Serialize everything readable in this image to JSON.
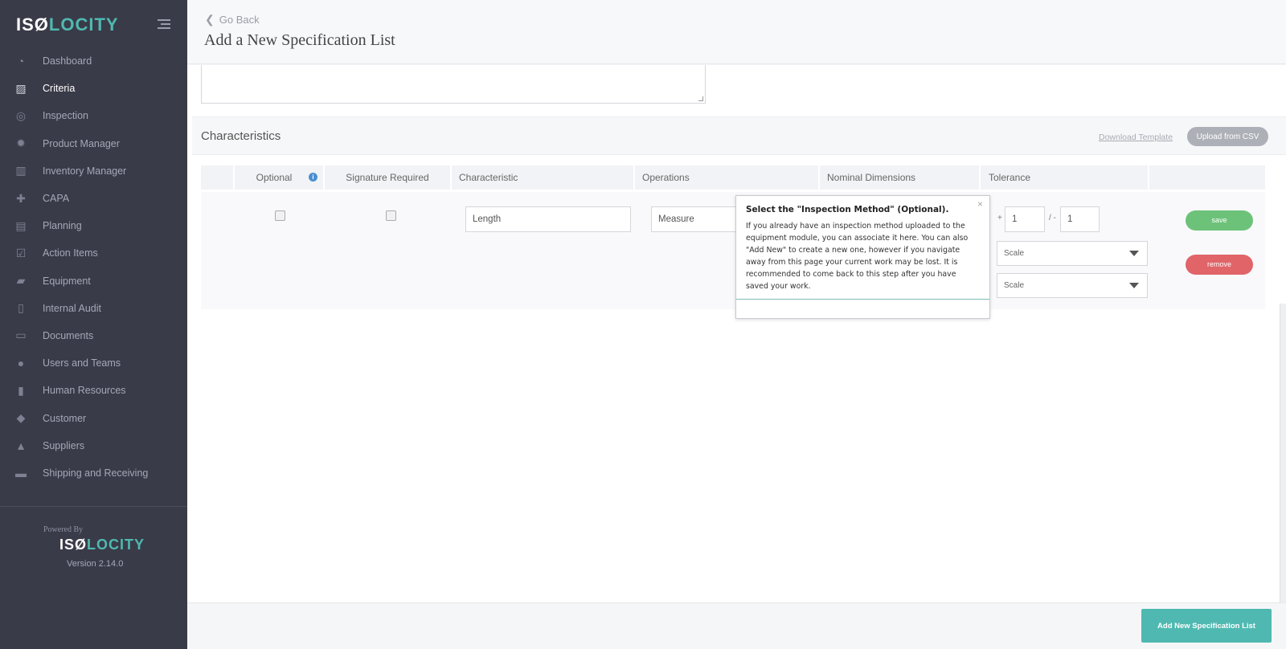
{
  "brand": {
    "logo_left": "IS",
    "logo_mid": "Ø",
    "logo_right": "LOCITY"
  },
  "sidebar": {
    "items": [
      {
        "label": "Dashboard",
        "icon": "dashboard-icon",
        "glyph": "◔"
      },
      {
        "label": "Criteria",
        "icon": "image-icon",
        "glyph": "▨",
        "active": true
      },
      {
        "label": "Inspection",
        "icon": "target-icon",
        "glyph": "◎"
      },
      {
        "label": "Product Manager",
        "icon": "gear-icon",
        "glyph": "✹"
      },
      {
        "label": "Inventory Manager",
        "icon": "barcode-icon",
        "glyph": "▥"
      },
      {
        "label": "CAPA",
        "icon": "medkit-icon",
        "glyph": "✚"
      },
      {
        "label": "Planning",
        "icon": "map-icon",
        "glyph": "▤"
      },
      {
        "label": "Action Items",
        "icon": "checkbox-icon",
        "glyph": "☑"
      },
      {
        "label": "Equipment",
        "icon": "truck-icon",
        "glyph": "▰"
      },
      {
        "label": "Internal Audit",
        "icon": "document-icon",
        "glyph": "▯"
      },
      {
        "label": "Documents",
        "icon": "folder-icon",
        "glyph": "▭"
      },
      {
        "label": "Users and Teams",
        "icon": "users-icon",
        "glyph": "●"
      },
      {
        "label": "Human Resources",
        "icon": "book-icon",
        "glyph": "▮"
      },
      {
        "label": "Customer",
        "icon": "tag-icon",
        "glyph": "◆"
      },
      {
        "label": "Suppliers",
        "icon": "supplier-icon",
        "glyph": "▲"
      },
      {
        "label": "Shipping and Receiving",
        "icon": "inbox-icon",
        "glyph": "▬"
      }
    ],
    "powered_by": "Powered By",
    "version": "Version 2.14.0"
  },
  "header": {
    "go_back": "Go Back",
    "title": "Add a New Specification List"
  },
  "characteristics": {
    "title": "Characteristics",
    "download_template": "Download Template",
    "upload_csv": "Upload from CSV",
    "columns": {
      "optional": "Optional",
      "signature": "Signature Required",
      "characteristic": "Characteristic",
      "operations": "Operations",
      "nominal": "Nominal Dimensions",
      "tolerance": "Tolerance"
    },
    "row": {
      "characteristic_value": "Length",
      "operation_value": "Measure",
      "plus": "+",
      "tol_plus": "1",
      "slash_minus": "/ -",
      "tol_minus": "1",
      "scale1": "Scale",
      "scale2": "Scale",
      "save": "save",
      "remove": "remove"
    }
  },
  "tooltip": {
    "close": "×",
    "title": "Select the \"Inspection Method\" (Optional).",
    "body": "If you already have an inspection method uploaded to the equipment module, you can associate it here. You can also \"Add New\" to create a new one, however if you navigate away from this page your current work may be lost. It is recommended to come back to this step after you have saved your work."
  },
  "footer": {
    "add_button": "Add New Specification List"
  },
  "colors": {
    "sidebar": "#3a3b48",
    "accent": "#4fb9b1",
    "save": "#6dc27a",
    "remove": "#e06468"
  }
}
